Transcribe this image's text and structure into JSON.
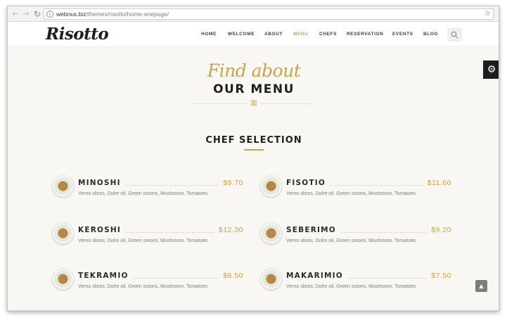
{
  "browser": {
    "back_glyph": "←",
    "forward_glyph": "→",
    "reload_glyph": "↻",
    "url_host": "webnus.biz",
    "url_path": "/themes/risotto/home-onepage/",
    "bookmark_glyph": "☆"
  },
  "header": {
    "logo": "Risotto",
    "nav": [
      "HOME",
      "WELCOME",
      "ABOUT",
      "MENU",
      "CHEFS",
      "RESERVATION",
      "EVENTS",
      "BLOG"
    ],
    "active_nav": "MENU",
    "search_icon": "search-icon"
  },
  "settings": {
    "icon": "gear-icon",
    "glyph": "⚙"
  },
  "hero": {
    "script_title": "Find about",
    "title": "OUR MENU",
    "divider_icon": "book-icon",
    "divider_glyph": "▥"
  },
  "section": {
    "heading": "CHEF SELECTION"
  },
  "menu": {
    "left": [
      {
        "name": "MINOSHI",
        "price": "$9.70",
        "description": "Verno slices, Dolre oil, Green onions, Mushroom, Tomatoes"
      },
      {
        "name": "KEROSHI",
        "price": "$12.30",
        "description": "Verno slices, Dolre oil, Green onions, Mushroom, Tomatoes"
      },
      {
        "name": "TEKRAMIO",
        "price": "$8.50",
        "description": "Verno slices, Dolre oil, Green onions, Mushroom, Tomatoes"
      }
    ],
    "right": [
      {
        "name": "FISOTIO",
        "price": "$11.60",
        "description": "Verno slices, Dolre oil, Green onions, Mushroom, Tomatoes"
      },
      {
        "name": "SEBERIMO",
        "price": "$9.20",
        "description": "Verno slices, Dolre oil, Green onions, Mushroom, Tomatoes"
      },
      {
        "name": "MAKARIMIO",
        "price": "$7.50",
        "description": "Verno slices, Dolre oil, Green onions, Mushroom, Tomatoes"
      }
    ]
  },
  "scroll_top": {
    "icon": "chevron-up-icon",
    "glyph": "▲"
  },
  "colors": {
    "accent": "#c9a24d",
    "text": "#1e1e1e",
    "background": "#f8f7f3"
  }
}
